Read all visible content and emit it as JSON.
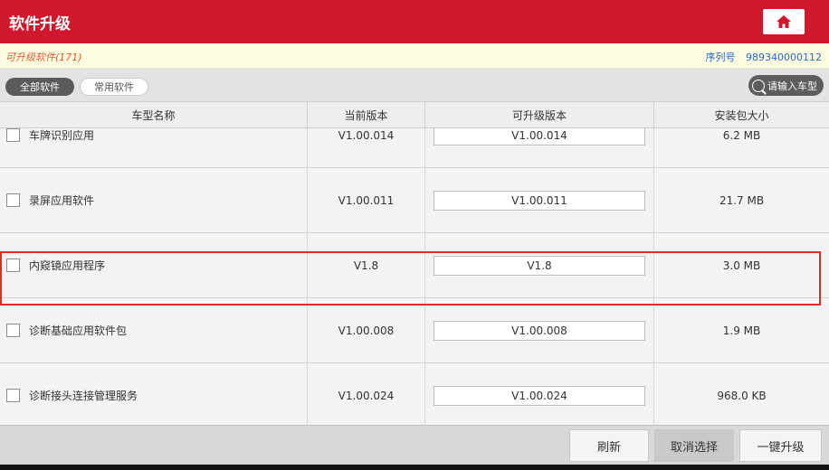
{
  "header": {
    "title": "软件升级",
    "home_icon": "home-icon"
  },
  "info": {
    "upgradable_label": "可升级软件(171)",
    "serial_label": "序列号",
    "serial_value": "989340000112"
  },
  "tabs": [
    {
      "label": "全部软件",
      "active": true
    },
    {
      "label": "常用软件",
      "active": false
    }
  ],
  "search": {
    "placeholder": "请输入车型",
    "icon": "search-icon"
  },
  "table": {
    "headers": [
      "车型名称",
      "当前版本",
      "可升级版本",
      "安装包大小"
    ],
    "rows": [
      {
        "name": "车牌识别应用",
        "current": "V1.00.014",
        "upgrade": "V1.00.014",
        "size": "6.2 MB"
      },
      {
        "name": "录屏应用软件",
        "current": "V1.00.011",
        "upgrade": "V1.00.011",
        "size": "21.7 MB"
      },
      {
        "name": "内窥镜应用程序",
        "current": "V1.8",
        "upgrade": "V1.8",
        "size": "3.0 MB"
      },
      {
        "name": "诊断基础应用软件包",
        "current": "V1.00.008",
        "upgrade": "V1.00.008",
        "size": "1.9 MB"
      },
      {
        "name": "诊断接头连接管理服务",
        "current": "V1.00.024",
        "upgrade": "V1.00.024",
        "size": "968.0 KB"
      }
    ]
  },
  "footer": {
    "refresh": "刷新",
    "cancel_select": "取消选择",
    "one_key_upgrade": "一键升级"
  },
  "colors": {
    "header_red": "#d0172b",
    "highlight_red": "#e8262a",
    "serial_blue": "#2a67c7"
  }
}
